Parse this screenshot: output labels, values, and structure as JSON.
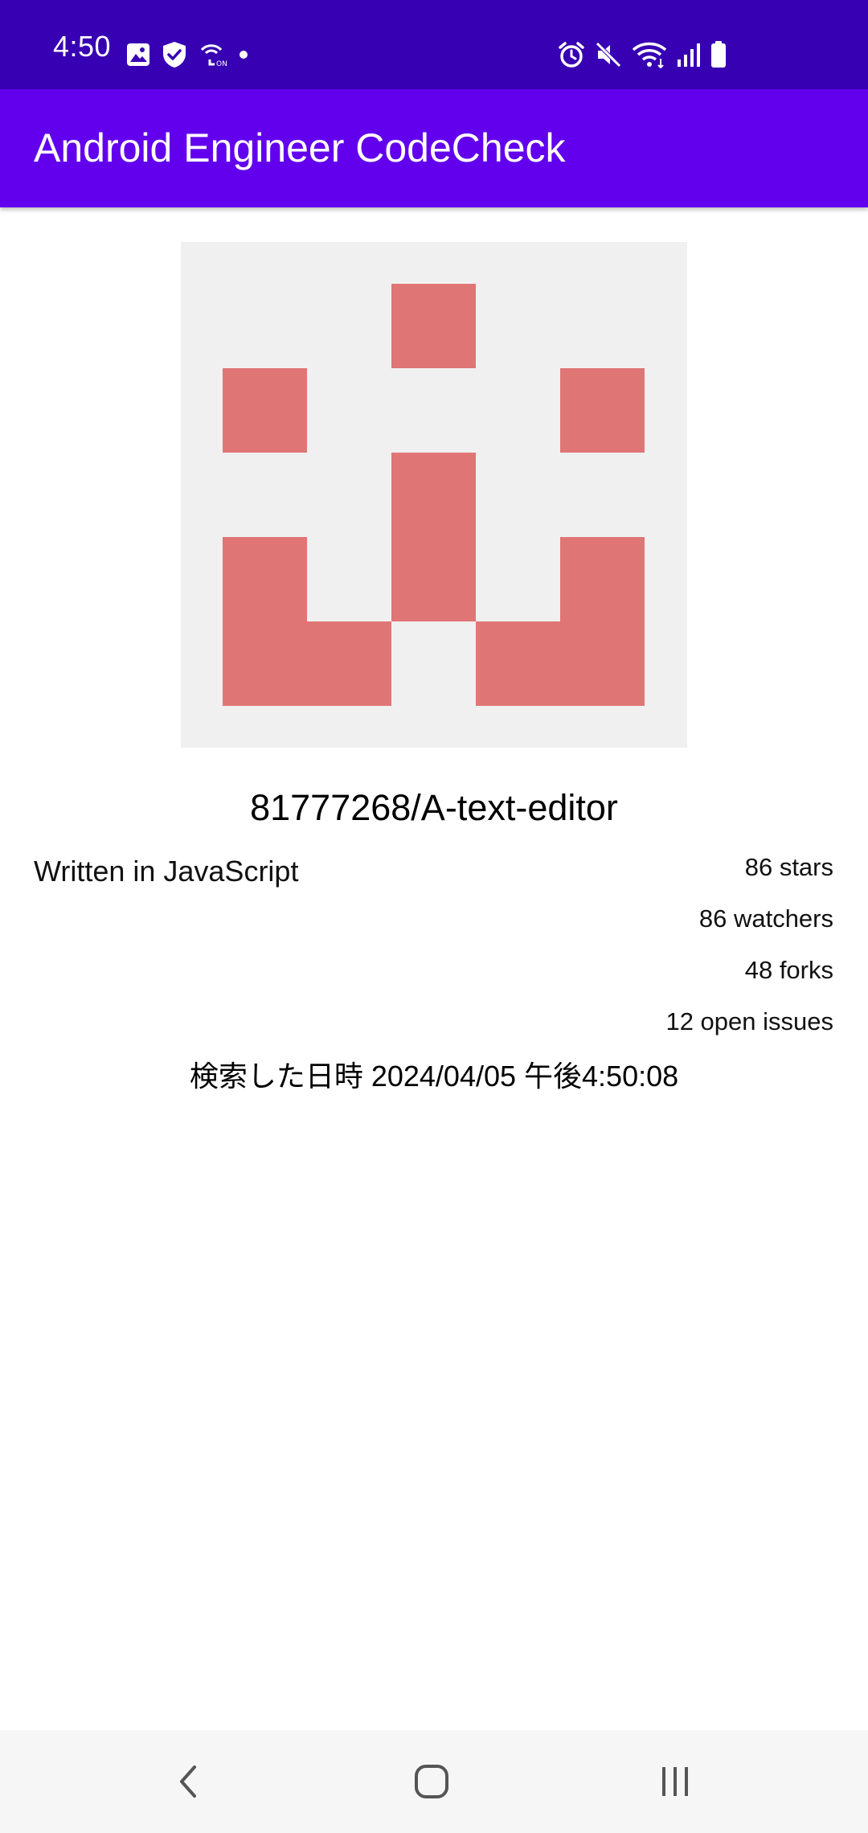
{
  "status_bar": {
    "time": "4:50",
    "left_icons": [
      "gallery-icon",
      "shield-icon",
      "call-on-icon",
      "dot-icon"
    ],
    "right_icons": [
      "alarm-icon",
      "mute-icon",
      "wifi-icon",
      "signal-icon",
      "battery-icon"
    ],
    "background": "#3700B3"
  },
  "app_bar": {
    "title": "Android Engineer CodeCheck",
    "background": "#6200EE"
  },
  "repository": {
    "avatar_icon": "identicon-avatar",
    "avatar_color": "#E07575",
    "avatar_background": "#F0F0F0",
    "name": "81777268/A-text-editor",
    "language": "Written in JavaScript",
    "stars": "86 stars",
    "watchers": "86 watchers",
    "forks": "48 forks",
    "open_issues": "12 open issues",
    "searched_at": "検索した日時 2024/04/05 午後4:50:08"
  },
  "nav_bar": {
    "buttons": [
      "back-icon",
      "home-icon",
      "recents-icon"
    ]
  }
}
